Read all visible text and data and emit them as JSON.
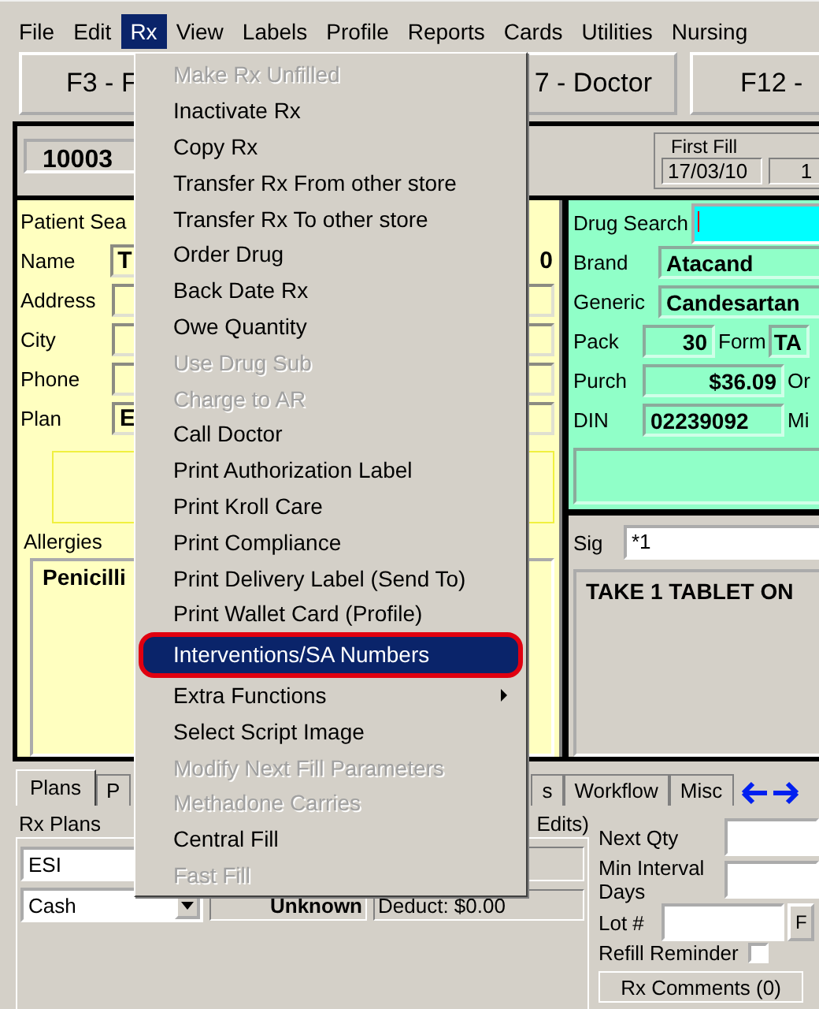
{
  "menu_bar": [
    {
      "label": "File",
      "selected": false
    },
    {
      "label": "Edit",
      "selected": false
    },
    {
      "label": "Rx",
      "selected": true
    },
    {
      "label": "View",
      "selected": false
    },
    {
      "label": "Labels",
      "selected": false
    },
    {
      "label": "Profile",
      "selected": false
    },
    {
      "label": "Reports",
      "selected": false
    },
    {
      "label": "Cards",
      "selected": false
    },
    {
      "label": "Utilities",
      "selected": false
    },
    {
      "label": "Nursing",
      "selected": false
    }
  ],
  "function_buttons": [
    "F3 - F",
    "7 - Doctor",
    "F12 -"
  ],
  "rx_number": "10003",
  "first_fill": {
    "label": "First Fill",
    "date": "17/03/10",
    "count": "1"
  },
  "patient": {
    "search_label": "Patient Sea",
    "fields": [
      {
        "label": "Name",
        "value": "T",
        "extra": "0"
      },
      {
        "label": "Address"
      },
      {
        "label": "City"
      },
      {
        "label": "Phone"
      },
      {
        "label": "Plan",
        "value": "E"
      }
    ],
    "allergies_label": "Allergies",
    "allergies": [
      "Penicilli"
    ]
  },
  "drug": {
    "search_label": "Drug Search",
    "brand_label": "Brand",
    "brand": "Atacand",
    "generic_label": "Generic",
    "generic": "Candesartan",
    "pack_label": "Pack",
    "pack": "30",
    "form_label": "Form",
    "form": "TA",
    "purch_label": "Purch",
    "purch": "$36.09",
    "purch_side": "Or",
    "din_label": "DIN",
    "din": "02239092",
    "din_side": "Mi"
  },
  "sig": {
    "label": "Sig",
    "value": "*1",
    "directions": "TAKE 1 TABLET ON"
  },
  "bottom_tabs": [
    {
      "label": "Plans",
      "selected": true
    },
    {
      "label": "P",
      "selected": false
    },
    {
      "label": "s",
      "selected": false
    },
    {
      "label": "Workflow",
      "selected": false
    },
    {
      "label": "Misc",
      "selected": false
    }
  ],
  "plans": {
    "label": "Rx Plans",
    "edits": "Edits)",
    "plan": "ESI",
    "payment": "Cash",
    "status": "Unknown",
    "deduct": "Deduct: $0.00"
  },
  "fill": {
    "next_qty_label": "Next Qty",
    "min_interval_label": "Min Interval Days",
    "lot_label": "Lot #",
    "lot_button": "F",
    "refill_reminder": {
      "label": "Refill Reminder",
      "checked": false
    },
    "comments_button": "Rx Comments (0)"
  },
  "rx_menu": [
    {
      "label": "Make Rx Unfilled",
      "disabled": true,
      "selected": false,
      "submenu": false
    },
    {
      "label": "Inactivate Rx",
      "disabled": false,
      "selected": false,
      "submenu": false
    },
    {
      "label": "Copy Rx",
      "disabled": false,
      "selected": false,
      "submenu": false
    },
    {
      "label": "Transfer Rx From other store",
      "disabled": false,
      "selected": false,
      "submenu": false
    },
    {
      "label": "Transfer Rx To other store",
      "disabled": false,
      "selected": false,
      "submenu": false
    },
    {
      "label": "Order Drug",
      "disabled": false,
      "selected": false,
      "submenu": false
    },
    {
      "label": "Back Date Rx",
      "disabled": false,
      "selected": false,
      "submenu": false
    },
    {
      "label": "Owe Quantity",
      "disabled": false,
      "selected": false,
      "submenu": false
    },
    {
      "label": "Use Drug Sub",
      "disabled": true,
      "selected": false,
      "submenu": false
    },
    {
      "label": "Charge to AR",
      "disabled": true,
      "selected": false,
      "submenu": false
    },
    {
      "label": "Call Doctor",
      "disabled": false,
      "selected": false,
      "submenu": false
    },
    {
      "label": "Print Authorization Label",
      "disabled": false,
      "selected": false,
      "submenu": false
    },
    {
      "label": "Print Kroll Care",
      "disabled": false,
      "selected": false,
      "submenu": false
    },
    {
      "label": "Print Compliance",
      "disabled": false,
      "selected": false,
      "submenu": false
    },
    {
      "label": "Print Delivery Label (Send To)",
      "disabled": false,
      "selected": false,
      "submenu": false
    },
    {
      "label": "Print Wallet Card (Profile)",
      "disabled": false,
      "selected": false,
      "submenu": false
    },
    {
      "label": "Interventions/SA Numbers",
      "disabled": false,
      "selected": true,
      "submenu": false
    },
    {
      "label": "Extra Functions",
      "disabled": false,
      "selected": false,
      "submenu": true
    },
    {
      "label": "Select Script Image",
      "disabled": false,
      "selected": false,
      "submenu": false
    },
    {
      "label": "Modify Next Fill Parameters",
      "disabled": true,
      "selected": false,
      "submenu": false
    },
    {
      "label": "Methadone Carries",
      "disabled": true,
      "selected": false,
      "submenu": false
    },
    {
      "label": "Central Fill",
      "disabled": false,
      "selected": false,
      "submenu": false
    },
    {
      "label": "Fast Fill",
      "disabled": true,
      "selected": false,
      "submenu": false
    }
  ]
}
